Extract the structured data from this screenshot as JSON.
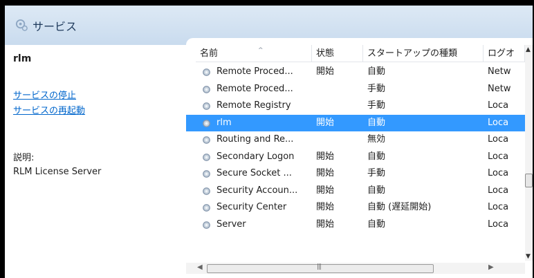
{
  "window": {
    "title": "サービス",
    "icon": "gear-icon"
  },
  "details": {
    "service_name": "rlm",
    "stop_link": "サービスの停止",
    "restart_link": "サービスの再起動",
    "description_label": "説明:",
    "description": "RLM License Server"
  },
  "columns": [
    "名前",
    "状態",
    "スタートアップの種類",
    "ログオ"
  ],
  "rows": [
    {
      "name": "Remote Proced...",
      "status": "開始",
      "startup": "自動",
      "logon": "Netw"
    },
    {
      "name": "Remote Proced...",
      "status": "",
      "startup": "手動",
      "logon": "Netw"
    },
    {
      "name": "Remote Registry",
      "status": "",
      "startup": "手動",
      "logon": "Loca"
    },
    {
      "name": "rlm",
      "status": "開始",
      "startup": "自動",
      "logon": "Loca",
      "selected": true
    },
    {
      "name": "Routing and Re...",
      "status": "",
      "startup": "無効",
      "logon": "Loca"
    },
    {
      "name": "Secondary Logon",
      "status": "開始",
      "startup": "自動",
      "logon": "Loca"
    },
    {
      "name": "Secure Socket ...",
      "status": "開始",
      "startup": "手動",
      "logon": "Loca"
    },
    {
      "name": "Security Accoun...",
      "status": "開始",
      "startup": "自動",
      "logon": "Loca"
    },
    {
      "name": "Security Center",
      "status": "開始",
      "startup": "自動 (遅延開始)",
      "logon": "Loca"
    },
    {
      "name": "Server",
      "status": "開始",
      "startup": "自動",
      "logon": "Loca"
    }
  ],
  "colors": {
    "selection": "#3399ff",
    "link": "#0066cc",
    "header_bg": "#dde9f5"
  }
}
